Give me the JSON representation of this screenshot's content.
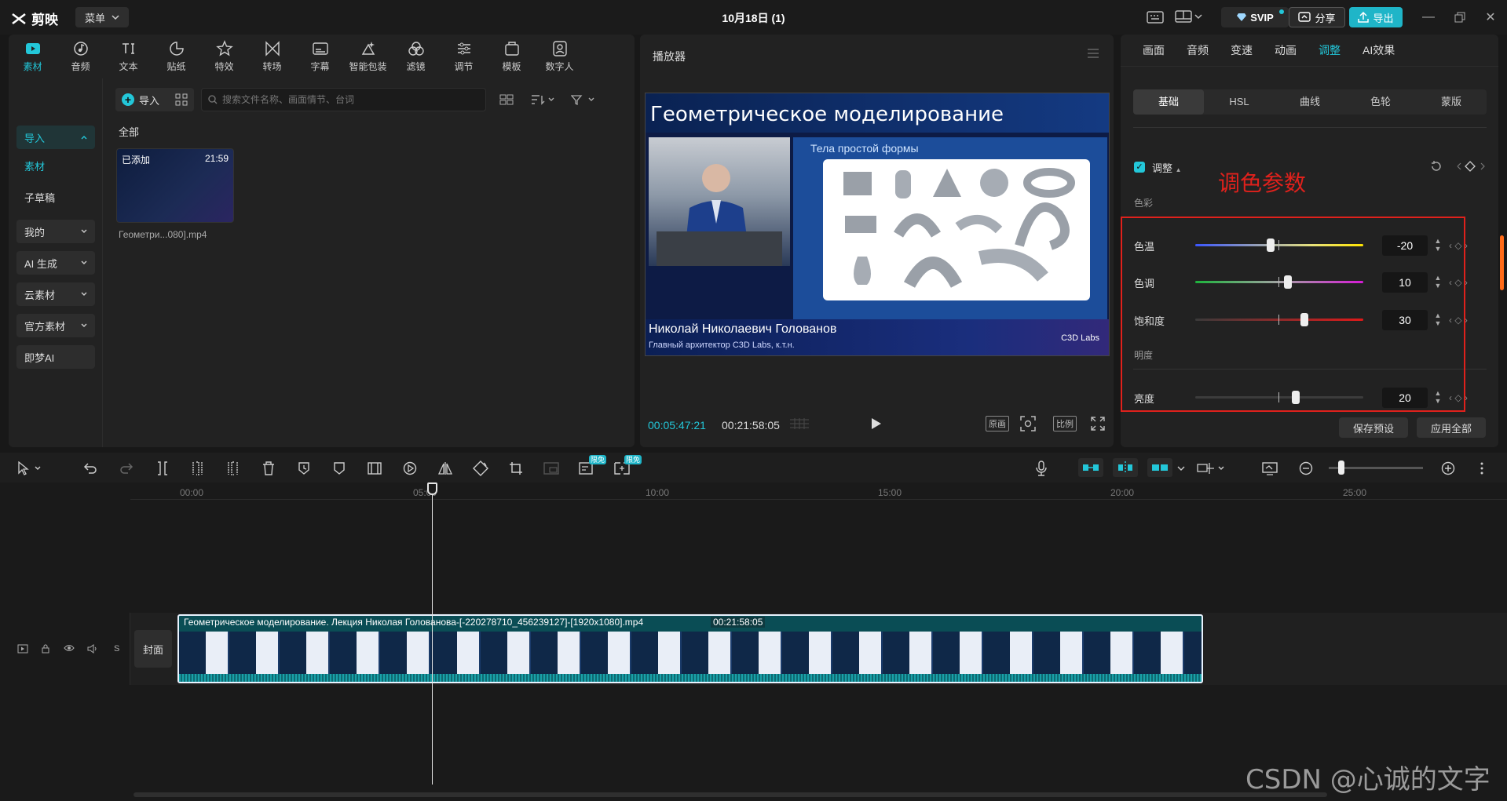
{
  "app": {
    "logo_text": "剪映",
    "menu_label": "菜单",
    "project_title": "10月18日 (1)"
  },
  "titlebar": {
    "svip_label": "SVIP",
    "share_label": "分享",
    "export_label": "导出"
  },
  "media_tools": [
    {
      "label": "素材",
      "icon": "media-icon"
    },
    {
      "label": "音频",
      "icon": "audio-icon"
    },
    {
      "label": "文本",
      "icon": "text-icon"
    },
    {
      "label": "贴纸",
      "icon": "sticker-icon"
    },
    {
      "label": "特效",
      "icon": "effects-icon"
    },
    {
      "label": "转场",
      "icon": "transition-icon"
    },
    {
      "label": "字幕",
      "icon": "subtitle-icon"
    },
    {
      "label": "智能包装",
      "icon": "smart-pack-icon"
    },
    {
      "label": "滤镜",
      "icon": "filter-icon"
    },
    {
      "label": "调节",
      "icon": "adjust-icon"
    },
    {
      "label": "模板",
      "icon": "template-icon"
    },
    {
      "label": "数字人",
      "icon": "avatar-icon"
    }
  ],
  "sidebar": {
    "import": "导入",
    "material": "素材",
    "sub_draft": "子草稿",
    "mine": "我的",
    "ai_gen": "AI 生成",
    "cloud": "云素材",
    "official": "官方素材",
    "jimeng": "即梦AI"
  },
  "media": {
    "import_label": "导入",
    "search_placeholder": "搜索文件名称、画面情节、台词",
    "section_all": "全部",
    "item": {
      "badge": "已添加",
      "duration": "21:59",
      "name": "Геометри...080].mp4"
    }
  },
  "player": {
    "title": "播放器",
    "video": {
      "title": "Геометрическое моделирование",
      "slide_subtitle": "Тела простой формы",
      "presenter": "Николай Николаевич Голованов",
      "presenter_role": "Главный архитектор C3D Labs, к.т.н.",
      "brand": "C3D Labs"
    },
    "time_current": "00:05:47:21",
    "time_total": "00:21:58:05",
    "btn_original": "原画",
    "btn_ratio": "比例"
  },
  "inspector": {
    "tabs": [
      "画面",
      "音频",
      "变速",
      "动画",
      "调整",
      "AI效果"
    ],
    "active_tab": "调整",
    "subtabs": [
      "基础",
      "HSL",
      "曲线",
      "色轮",
      "蒙版"
    ],
    "active_subtab": "基础",
    "adjust_label": "调整",
    "annotation": "调色参数",
    "group_color": "色彩",
    "group_light": "明度",
    "sliders": [
      {
        "label": "色温",
        "value": -20,
        "display": "-20",
        "fraction": 0.45
      },
      {
        "label": "色调",
        "value": 10,
        "display": "10",
        "fraction": 0.55
      },
      {
        "label": "饱和度",
        "value": 30,
        "display": "30",
        "fraction": 0.65
      },
      {
        "label": "亮度",
        "value": 20,
        "display": "20",
        "fraction": 0.6
      }
    ],
    "save_preset": "保存预设",
    "apply_all": "应用全部"
  },
  "timeline": {
    "badge": "限免",
    "ticks": [
      "00:00",
      "05:00",
      "10:00",
      "15:00",
      "20:00",
      "25:00"
    ],
    "cover_label": "封面",
    "clip_name": "Геометрическое моделирование. Лекция Николая Голованова-[-220278710_456239127]-[1920x1080].mp4",
    "clip_duration": "00:21:58:05",
    "playhead_fraction": 0.263
  },
  "watermark": "CSDN @心诚的文字",
  "colors": {
    "accent": "#23c7d9",
    "annotation_red": "#e0211c",
    "panel_bg": "#222222"
  }
}
